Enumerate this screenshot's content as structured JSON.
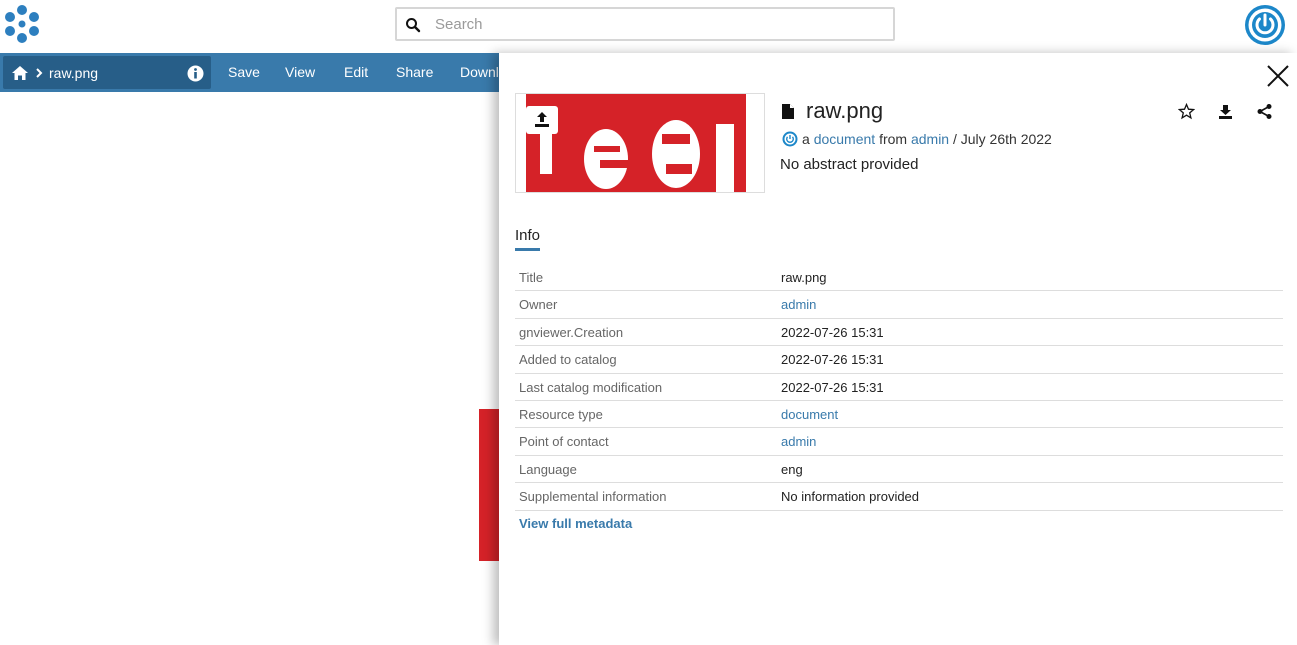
{
  "header": {
    "logo_icon": "geonode-logo-icon",
    "search": {
      "placeholder": "Search",
      "value": ""
    },
    "user_icon": "power-user-icon"
  },
  "actionbar": {
    "breadcrumb_home_icon": "home-icon",
    "breadcrumb_item": "raw.png",
    "info_icon": "info-icon",
    "menu": [
      "Save",
      "View",
      "Edit",
      "Share",
      "Downl"
    ]
  },
  "detail": {
    "title": "raw.png",
    "meta": {
      "prefix": "a",
      "type": "document",
      "from": "from",
      "owner": "admin",
      "date": "/ July 26th 2022"
    },
    "abstract": "No abstract provided",
    "tab": "Info",
    "rows": [
      {
        "key": "Title",
        "value": "raw.png",
        "link": false
      },
      {
        "key": "Owner",
        "value": "admin",
        "link": true
      },
      {
        "key": "gnviewer.Creation",
        "value": "2022-07-26 15:31",
        "link": false
      },
      {
        "key": "Added to catalog",
        "value": "2022-07-26 15:31",
        "link": false
      },
      {
        "key": "Last catalog modification",
        "value": "2022-07-26 15:31",
        "link": false
      },
      {
        "key": "Resource type",
        "value": "document",
        "link": true
      },
      {
        "key": "Point of contact",
        "value": "admin",
        "link": true
      },
      {
        "key": "Language",
        "value": "eng",
        "link": false
      },
      {
        "key": "Supplemental information",
        "value": "No information provided",
        "link": false
      }
    ],
    "full_metadata": "View full metadata"
  },
  "colors": {
    "brand_blue": "#397aab",
    "dark_blue": "#275e88",
    "accent_red": "#d52228",
    "logo_blue": "#1c87c9"
  }
}
